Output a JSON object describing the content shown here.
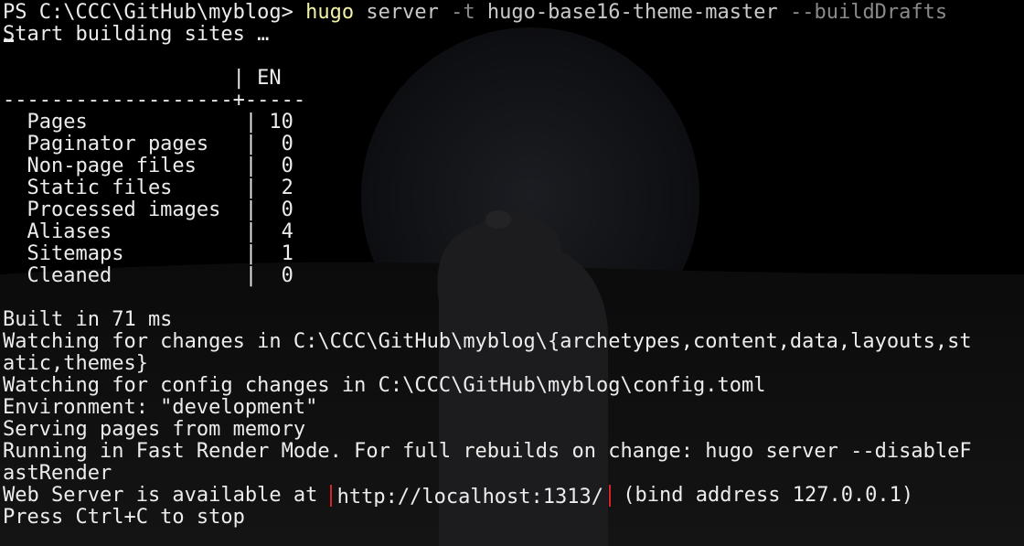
{
  "terminal": {
    "prompt": "PS C:\\CCC\\GitHub\\myblog> ",
    "command": {
      "program": "hugo",
      "subcommand": " server ",
      "flag_t": "-t",
      "theme": " hugo-base16-theme-master ",
      "flag_drafts": "--buildDrafts"
    },
    "building": "Start building sites …",
    "stats": {
      "header": "                   | EN",
      "separator": "-------------------+-----",
      "rows": [
        "  Pages             | 10",
        "  Paginator pages   |  0",
        "  Non-page files    |  0",
        "  Static files      |  2",
        "  Processed images  |  0",
        "  Aliases           |  4",
        "  Sitemaps          |  1",
        "  Cleaned           |  0"
      ]
    },
    "built": "Built in 71 ms",
    "watching_1": "Watching for changes in C:\\CCC\\GitHub\\myblog\\{archetypes,content,data,layouts,st",
    "watching_2": "atic,themes}",
    "watching_config": "Watching for config changes in C:\\CCC\\GitHub\\myblog\\config.toml",
    "environment": "Environment: \"development\"",
    "serving": "Serving pages from memory",
    "fast_render_1": "Running in Fast Render Mode. For full rebuilds on change: hugo server --disableF",
    "fast_render_2": "astRender",
    "web_server": {
      "prefix": "Web Server is available at ",
      "url": "http://localhost:1313/",
      "suffix": " (bind address 127.0.0.1)"
    },
    "stop": "Press Ctrl+C to stop"
  },
  "colors": {
    "background": "#000000",
    "text": "#ececec",
    "command": "#f2f2a6",
    "flag": "#8a8a8a",
    "highlight_box": "#d3232b"
  }
}
